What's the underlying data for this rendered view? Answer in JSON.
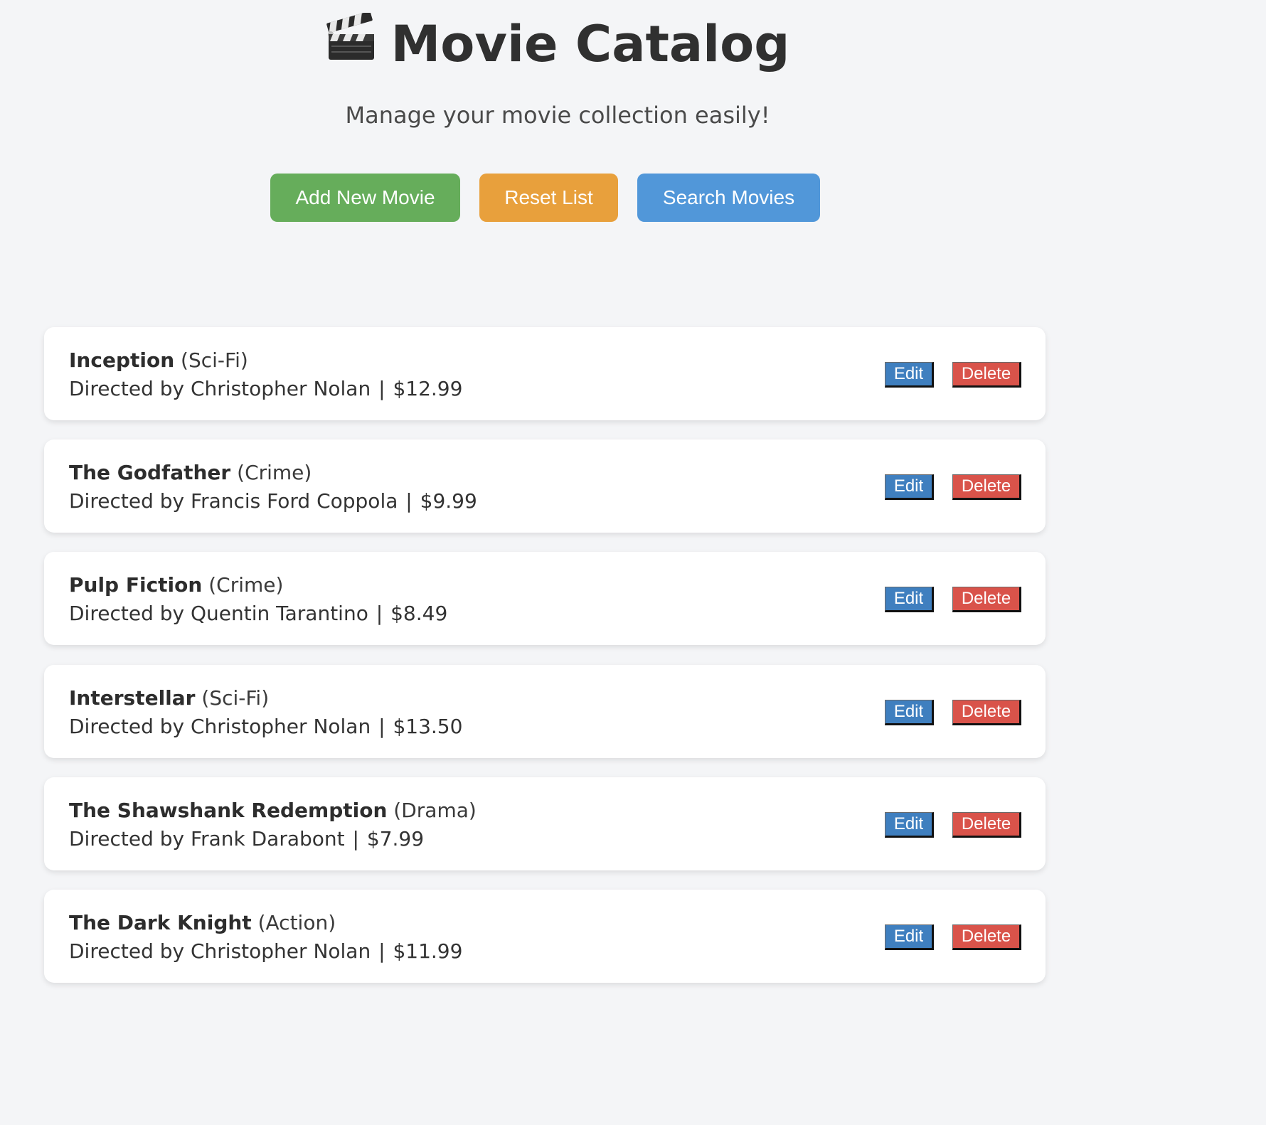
{
  "header": {
    "title": "Movie Catalog",
    "subtitle": "Manage your movie collection easily!"
  },
  "actions": {
    "add_label": "Add New Movie",
    "reset_label": "Reset List",
    "search_label": "Search Movies"
  },
  "colors": {
    "add": "#66ad5b",
    "reset": "#e8a03c",
    "search": "#5197d9",
    "edit": "#3f7fbf",
    "delete": "#d9534a",
    "background": "#f4f5f7"
  },
  "labels": {
    "edit": "Edit",
    "delete": "Delete",
    "directed_by": "Directed by",
    "separator": "|"
  },
  "movies": [
    {
      "title": "Inception",
      "genre": "(Sci-Fi)",
      "director": "Christopher Nolan",
      "price": "$12.99"
    },
    {
      "title": "The Godfather",
      "genre": "(Crime)",
      "director": "Francis Ford Coppola",
      "price": "$9.99"
    },
    {
      "title": "Pulp Fiction",
      "genre": "(Crime)",
      "director": "Quentin Tarantino",
      "price": "$8.49"
    },
    {
      "title": "Interstellar",
      "genre": "(Sci-Fi)",
      "director": "Christopher Nolan",
      "price": "$13.50"
    },
    {
      "title": "The Shawshank Redemption",
      "genre": "(Drama)",
      "director": "Frank Darabont",
      "price": "$7.99"
    },
    {
      "title": "The Dark Knight",
      "genre": "(Action)",
      "director": "Christopher Nolan",
      "price": "$11.99"
    }
  ],
  "icons": {
    "title_icon": "clapperboard-icon"
  }
}
